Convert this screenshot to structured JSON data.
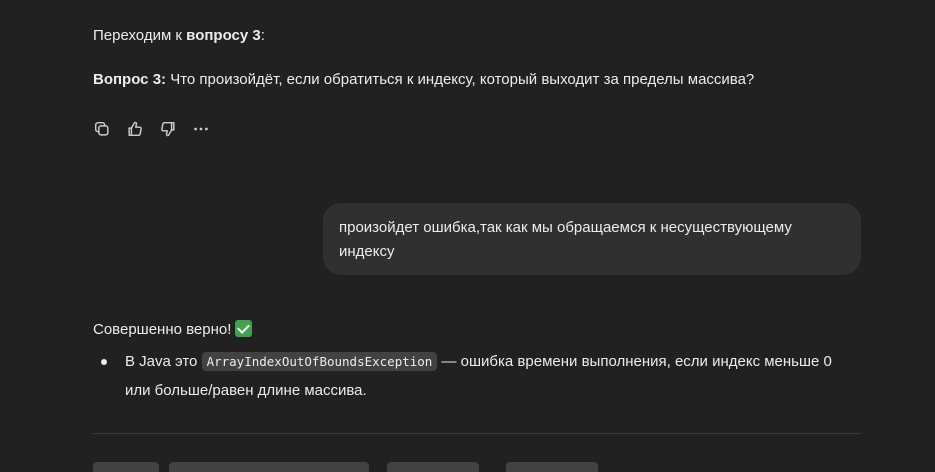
{
  "assistant_message_1": {
    "intro_prefix": "Переходим к ",
    "intro_bold": "вопросу 3",
    "intro_suffix": ":",
    "question_label": "Вопрос 3:",
    "question_text": " Что произойдёт, если обратиться к индексу, который выходит за пределы массива?"
  },
  "actions": {
    "icons": [
      "copy-icon",
      "thumbs-up-icon",
      "thumbs-down-icon",
      "more-icon"
    ]
  },
  "user_message": {
    "line1": "произойдет ошибка,так как мы обращаемся к несуществующему",
    "line2": "индексу"
  },
  "assistant_message_2": {
    "confirmation": "Совершенно верно!",
    "confirmation_emoji": "check-mark-icon",
    "bullet_prefix": "В Java это ",
    "bullet_code": "ArrayIndexOutOfBoundsException",
    "bullet_suffix": " — ошибка времени выполнения, если индекс меньше 0",
    "bullet_line2": "или больше/равен длине массива."
  },
  "colors": {
    "background": "#212121",
    "user_bubble": "#303030",
    "text": "#ececec",
    "code_bg": "#424242",
    "check_green": "#3fa34d"
  }
}
